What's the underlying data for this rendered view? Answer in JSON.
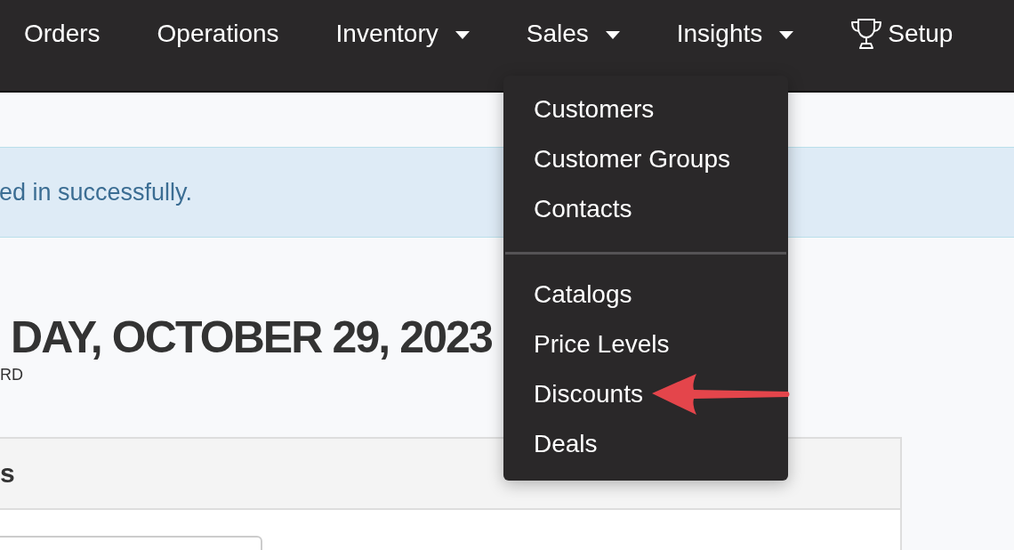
{
  "nav": [
    {
      "label": "Orders",
      "kind": "link"
    },
    {
      "label": "Operations",
      "kind": "link"
    },
    {
      "label": "Inventory",
      "kind": "dropdown"
    },
    {
      "label": "Sales",
      "kind": "dropdown",
      "menu": {
        "sections": [
          {
            "items": [
              {
                "label": "Customers",
                "marked": false
              },
              {
                "label": "Customer Groups",
                "marked": false
              },
              {
                "label": "Contacts",
                "marked": false
              }
            ]
          },
          {
            "items": [
              {
                "label": "Catalogs",
                "marked": false
              },
              {
                "label": "Price Levels",
                "marked": false
              },
              {
                "label": "Discounts",
                "marked": true
              },
              {
                "label": "Deals",
                "marked": false
              }
            ]
          }
        ]
      }
    },
    {
      "label": "Insights",
      "kind": "dropdown"
    },
    {
      "label": "Setup",
      "kind": "icon-link"
    }
  ],
  "alert": {
    "message": "ed in successfully."
  },
  "page_header": {
    "title": "DAY, OCTOBER 29, 2023",
    "subtitle": "RD"
  },
  "panel": {
    "title": "s"
  }
}
